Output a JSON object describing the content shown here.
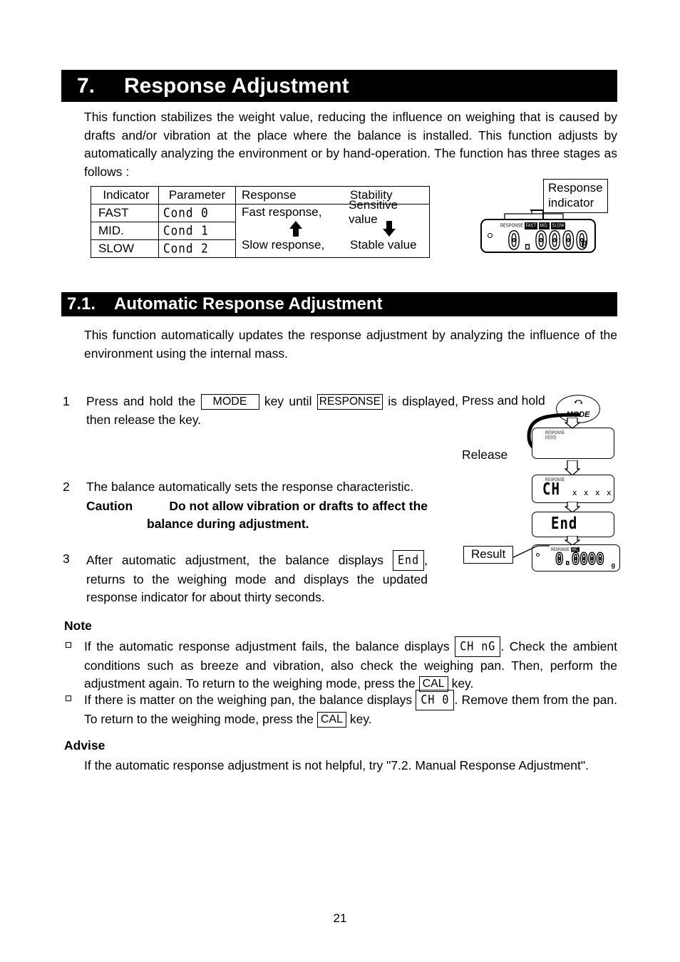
{
  "page": {
    "number": "21"
  },
  "section7": {
    "number": "7.",
    "title": "Response Adjustment",
    "intro": "This function stabilizes the weight value, reducing the influence on weighing that is caused by drafts and/or vibration at the place where the balance is installed. This function adjusts by automatically analyzing the environment or by hand-operation. The function has three stages as follows :"
  },
  "stage_table": {
    "headers": [
      "Indicator",
      "Parameter",
      "Response",
      "Stability"
    ],
    "rows": [
      {
        "indicator": "FAST",
        "parameter": "Cond 0"
      },
      {
        "indicator": "MID.",
        "parameter": "Cond  1"
      },
      {
        "indicator": "SLOW",
        "parameter": "Cond 2"
      }
    ],
    "response_top": "Fast response,",
    "stability_top": "Sensitive value",
    "response_bottom": "Slow response,",
    "stability_bottom": "Stable value",
    "response_arrow": "up-arrow",
    "stability_arrow": "down-arrow"
  },
  "display_top": {
    "annunciator_label": "RESPONSE",
    "annunciators": [
      "FAST",
      "MID.",
      "SLOW"
    ],
    "value": "0.0000",
    "unit": "g",
    "callout": "Response indicator"
  },
  "section71": {
    "number": "7.1.",
    "title": "Automatic Response Adjustment",
    "intro": "This function automatically updates the response adjustment by analyzing the influence of the environment using the internal mass."
  },
  "steps": [
    {
      "number": "1",
      "text_a": "Press and hold the",
      "key1": "MODE",
      "text_b": "key until",
      "key2": "RESPONSE",
      "text_c": "is",
      "text_d": "displayed, then release the key."
    },
    {
      "number": "2",
      "text": "The balance automatically sets the response characteristic.",
      "caution_label": "Caution",
      "caution_line1": "Do not allow vibration or drafts to affect the",
      "caution_line2": "balance during adjustment."
    },
    {
      "number": "3",
      "text_a": "After automatic adjustment, the balance displays",
      "seg1": "End",
      "text_b": ",",
      "text_c": "returns to the weighing mode and displays the updated response indicator for about thirty seconds."
    }
  ],
  "flow": {
    "press_hold_label": "Press and hold",
    "release_label": "Release",
    "result_label": "Result",
    "mode_key_label": "MODE",
    "mode_key_icon": "circular-arrow-icon",
    "panel1_annunciator": "RESPONSE",
    "panel2_annunciator": "RESPONSE",
    "panel2_value": "CH",
    "panel2_blink": "x x x x",
    "panel3_value": "End",
    "panel4_annunciator": "RESPONSE",
    "panel4_indicator": "MID.",
    "panel4_value": "0.0000",
    "panel4_unit": "g"
  },
  "note": {
    "heading": "Note",
    "item1_a": "If the automatic response adjustment fails, the balance displays",
    "item1_seg": "CH nG",
    "item1_b": ". Check the ambient conditions such as breeze and vibration, also check the weighing pan. Then, perform the adjustment again. To return to the weighing mode, press the",
    "item1_key": "CAL",
    "item1_c": "key.",
    "item2_a": "If there is matter on the weighing pan, the balance displays",
    "item2_seg": "CH 0",
    "item2_b": ". Remove them from the pan. To return to the weighing mode, press the",
    "item2_key": "CAL",
    "item2_c": "key."
  },
  "advise": {
    "heading": "Advise",
    "text": "If the automatic response adjustment is not helpful, try \"7.2. Manual Response Adjustment\"."
  }
}
